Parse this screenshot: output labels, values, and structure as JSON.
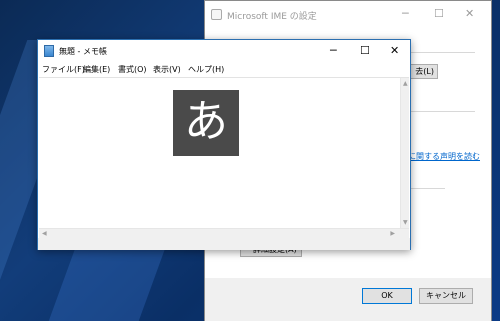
{
  "ime_dialog": {
    "title": "Microsoft IME の設定",
    "partial_button_label": "去(L)",
    "partial_link_text": "ーに関する声明を読む",
    "advanced_button_label": "詳細設定(A)",
    "ok_label": "OK",
    "cancel_label": "キャンセル"
  },
  "notepad": {
    "title": "無題 - メモ帳",
    "menu": [
      "ファイル(F)",
      "編集(E)",
      "書式(O)",
      "表示(V)",
      "ヘルプ(H)"
    ]
  },
  "ime_indicator": {
    "mode_char": "あ"
  }
}
